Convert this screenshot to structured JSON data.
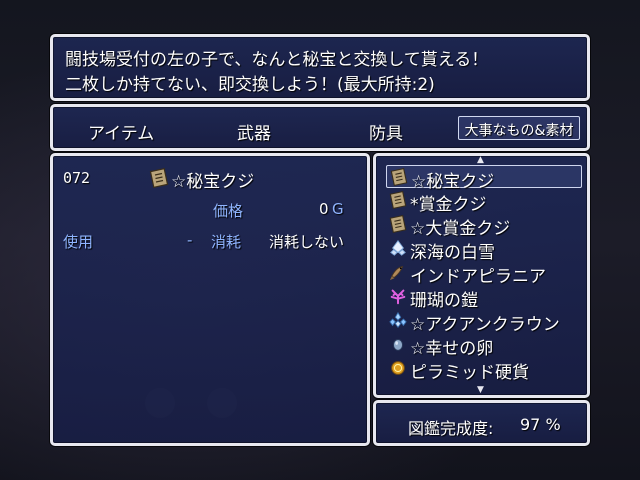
{
  "help": {
    "line1": "闘技場受付の左の子で、なんと秘宝と交換して貰える！",
    "line2": "二枚しか持てない、即交換しよう！(最大所持:2)"
  },
  "categories": {
    "items": [
      "アイテム",
      "武器",
      "防具",
      "大事なもの&素材"
    ],
    "selected": "大事なもの&素材"
  },
  "detail": {
    "number": "072",
    "name": "☆秘宝クジ",
    "price_label": "価格",
    "price_value": "0",
    "price_unit": "G",
    "use_label": "使用",
    "use_dash": "-",
    "consume_label": "消耗",
    "consume_value": "消耗しない"
  },
  "list": {
    "items": [
      {
        "name": "☆秘宝クジ",
        "icon": "ticket-icon"
      },
      {
        "name": "*賞金クジ",
        "icon": "ticket-icon"
      },
      {
        "name": "☆大賞金クジ",
        "icon": "ticket-icon"
      },
      {
        "name": "深海の白雪",
        "icon": "snow-crystal-icon"
      },
      {
        "name": "インドアピラニア",
        "icon": "fish-icon"
      },
      {
        "name": "珊瑚の鎧",
        "icon": "coral-icon"
      },
      {
        "name": "☆アクアンクラウン",
        "icon": "crystal-crown-icon"
      },
      {
        "name": "☆幸せの卵",
        "icon": "egg-icon"
      },
      {
        "name": "ピラミッド硬貨",
        "icon": "coin-icon"
      }
    ],
    "selected_index": 0
  },
  "completion": {
    "label": "図鑑完成度:",
    "value": "97 %"
  },
  "colors": {
    "window_bg": "#1e2856",
    "border": "#e8e8f0",
    "system_text": "#8fb4ff",
    "text": "#ffffff"
  }
}
